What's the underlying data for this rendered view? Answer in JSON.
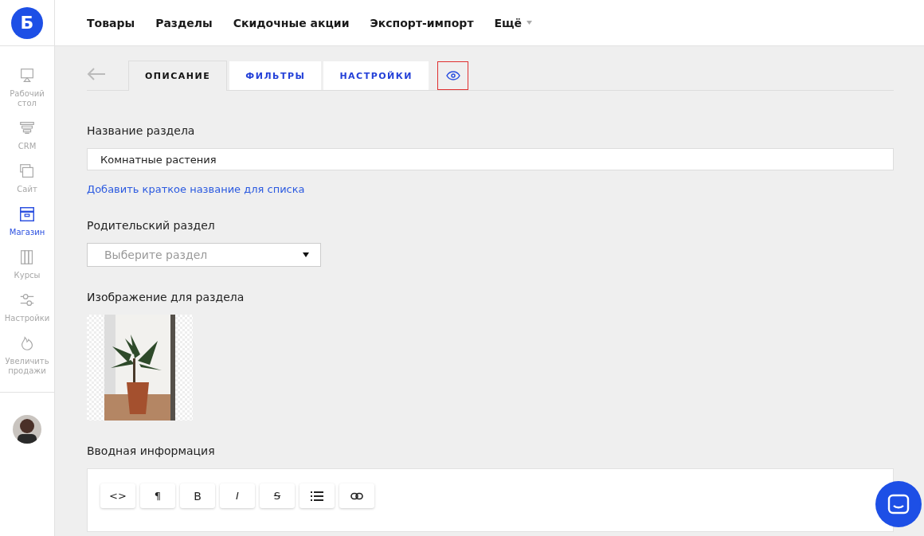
{
  "logo": {
    "letter": "Б"
  },
  "topnav": [
    "Товары",
    "Разделы",
    "Скидочные акции",
    "Экспорт-импорт",
    "Ещё"
  ],
  "sidebar": {
    "items": [
      {
        "label": "Рабочий стол",
        "selected": false
      },
      {
        "label": "CRM",
        "selected": false
      },
      {
        "label": "Сайт",
        "selected": false
      },
      {
        "label": "Магазин",
        "selected": true
      },
      {
        "label": "Курсы",
        "selected": false
      },
      {
        "label": "Настройки",
        "selected": false
      },
      {
        "label": "Увеличить продажи",
        "selected": false
      }
    ]
  },
  "tabs": [
    {
      "label": "ОПИСАНИЕ",
      "selected": true
    },
    {
      "label": "ФИЛЬТРЫ",
      "selected": false
    },
    {
      "label": "НАСТРОЙКИ",
      "selected": false
    }
  ],
  "form": {
    "name_label": "Название раздела",
    "name_value": "Комнатные растения",
    "short_name_link": "Добавить краткое название для списка",
    "parent_label": "Родительский раздел",
    "parent_placeholder": "Выберите раздел",
    "image_label": "Изображение для раздела",
    "intro_label": "Вводная информация"
  },
  "editor_toolbar": [
    {
      "kind": "text",
      "text": "<>"
    },
    {
      "kind": "text",
      "text": "¶"
    },
    {
      "kind": "bold",
      "text": "B"
    },
    {
      "kind": "italic",
      "text": "I"
    },
    {
      "kind": "strike",
      "text": "S"
    },
    {
      "kind": "list"
    },
    {
      "kind": "link"
    }
  ]
}
